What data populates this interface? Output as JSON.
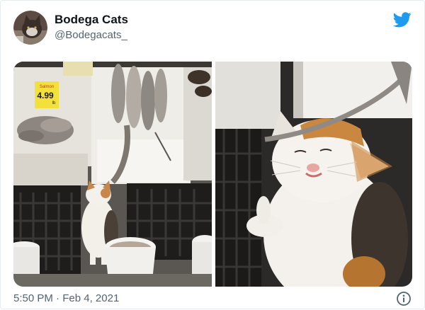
{
  "tweet": {
    "display_name": "Bodega Cats",
    "handle": "@Bodegacats_",
    "timestamp": "5:50 PM",
    "separator": "·",
    "date": "Feb 4, 2021"
  },
  "media": {
    "left_photo": {
      "price_sign": {
        "label": "Salmon",
        "price": "4.99",
        "unit": "lb"
      }
    }
  },
  "colors": {
    "brand_blue": "#1d9bf0",
    "muted_text": "#536471",
    "price_sign_yellow": "#f4e03a"
  },
  "icons": {
    "platform": "twitter-bird-icon",
    "info": "info-icon"
  }
}
